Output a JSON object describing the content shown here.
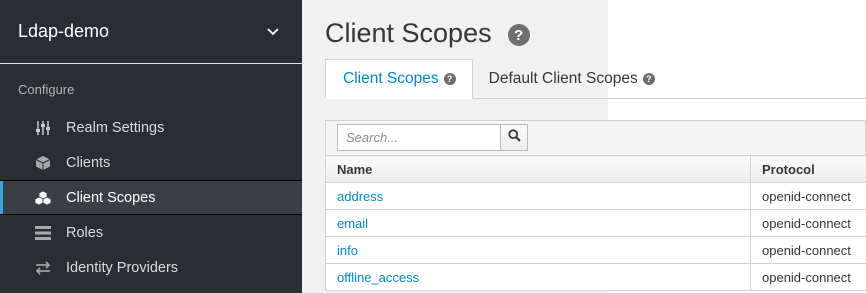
{
  "sidebar": {
    "realm": "Ldap-demo",
    "section": "Configure",
    "items": [
      {
        "label": "Realm Settings",
        "icon": "sliders-icon",
        "active": false
      },
      {
        "label": "Clients",
        "icon": "cube-icon",
        "active": false
      },
      {
        "label": "Client Scopes",
        "icon": "cubes-icon",
        "active": true
      },
      {
        "label": "Roles",
        "icon": "list-icon",
        "active": false
      },
      {
        "label": "Identity Providers",
        "icon": "exchange-icon",
        "active": false
      }
    ]
  },
  "main": {
    "title": "Client Scopes",
    "tabs": [
      {
        "label": "Client Scopes",
        "active": true
      },
      {
        "label": "Default Client Scopes",
        "active": false
      }
    ],
    "search": {
      "placeholder": "Search...",
      "value": ""
    },
    "table": {
      "columns": [
        "Name",
        "Protocol"
      ],
      "rows": [
        {
          "name": "address",
          "protocol": "openid-connect"
        },
        {
          "name": "email",
          "protocol": "openid-connect"
        },
        {
          "name": "info",
          "protocol": "openid-connect"
        },
        {
          "name": "offline_access",
          "protocol": "openid-connect"
        }
      ]
    }
  },
  "colors": {
    "sidebar_bg": "#292e34",
    "active_accent": "#39a5dc",
    "link": "#0088ce"
  }
}
